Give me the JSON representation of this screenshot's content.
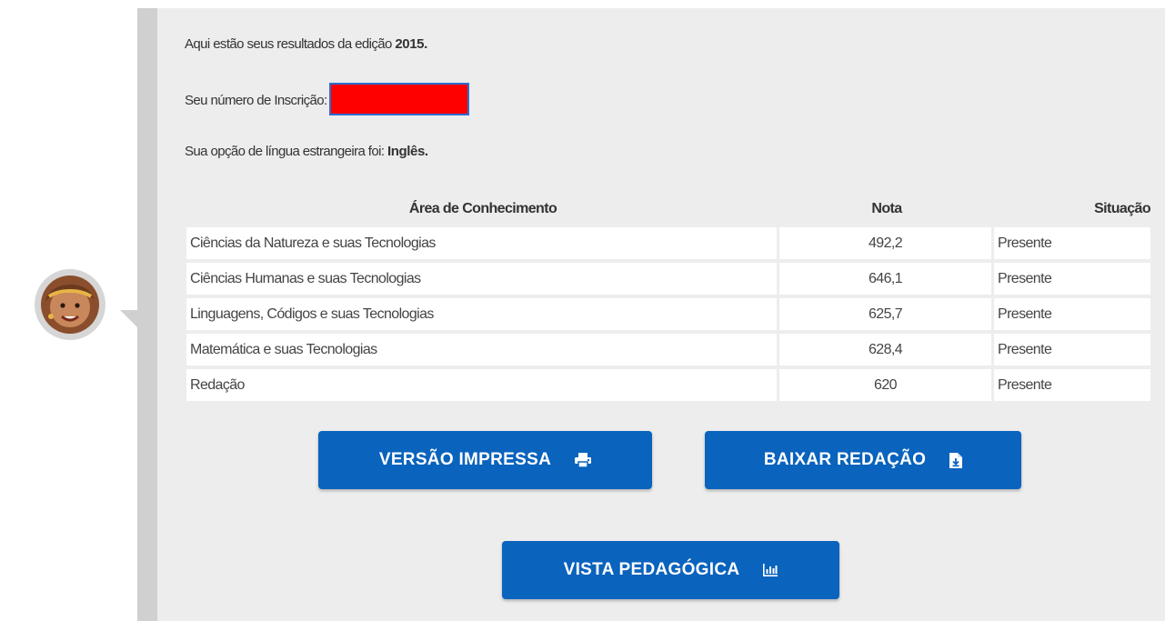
{
  "intro": {
    "edition_prefix": "Aqui estão seus resultados da edição",
    "edition_year": "2015.",
    "inscription_label": "Seu número de Inscrição:",
    "language_prefix": "Sua opção de língua estrangeira foi:",
    "language_value": "Inglês."
  },
  "table": {
    "headers": {
      "area": "Área de Conhecimento",
      "nota": "Nota",
      "situacao": "Situação"
    },
    "rows": [
      {
        "area": "Ciências da Natureza e suas Tecnologias",
        "nota": "492,2",
        "situacao": "Presente"
      },
      {
        "area": "Ciências Humanas e suas Tecnologias",
        "nota": "646,1",
        "situacao": "Presente"
      },
      {
        "area": "Linguagens, Códigos e suas Tecnologias",
        "nota": "625,7",
        "situacao": "Presente"
      },
      {
        "area": "Matemática e suas Tecnologias",
        "nota": "628,4",
        "situacao": "Presente"
      },
      {
        "area": "Redação",
        "nota": "620",
        "situacao": "Presente"
      }
    ]
  },
  "buttons": {
    "print": {
      "label": "VERSÃO IMPRESSA",
      "icon": "printer-icon"
    },
    "download": {
      "label": "BAIXAR REDAÇÃO",
      "icon": "file-download-icon"
    },
    "pedagogical": {
      "label": "VISTA PEDAGÓGICA",
      "icon": "bar-chart-icon"
    }
  },
  "colors": {
    "button_blue": "#0a63bd",
    "panel_bg": "#ededed",
    "redaction": "#ff0000"
  }
}
